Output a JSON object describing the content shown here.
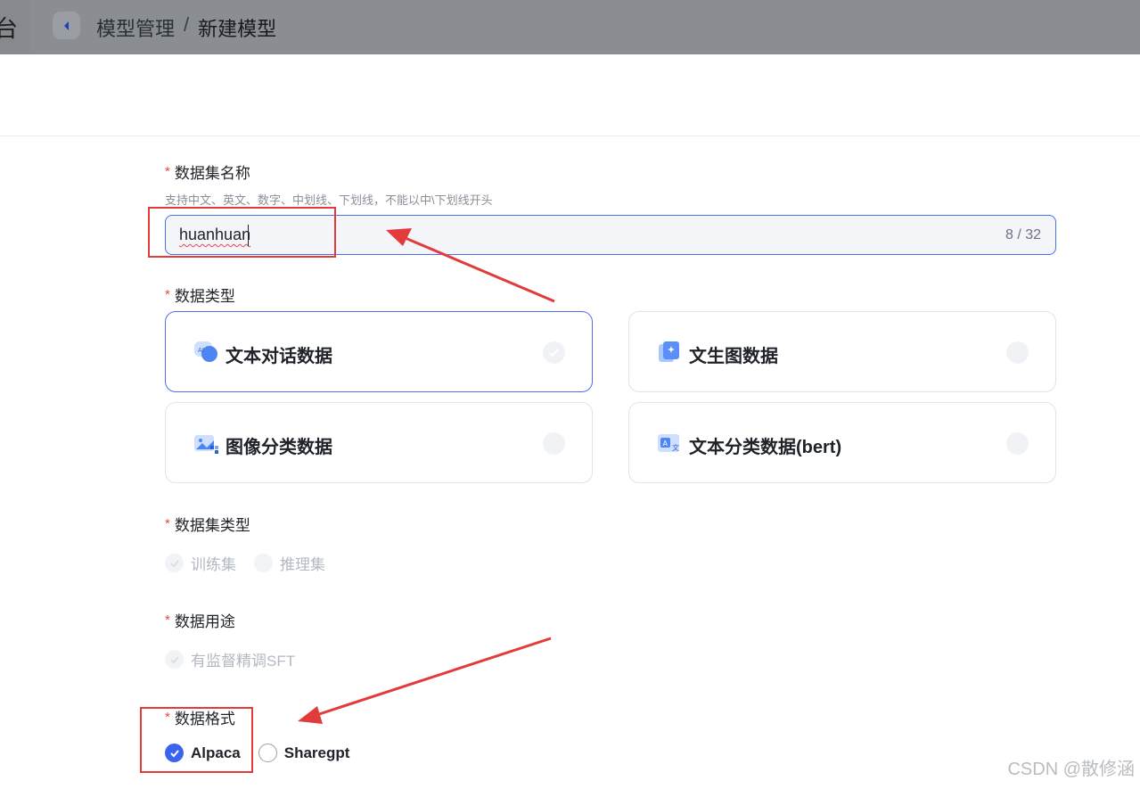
{
  "header": {
    "left_fragment": "台",
    "breadcrumb": [
      "模型管理",
      "/",
      "新建模型"
    ]
  },
  "form": {
    "dataset_name": {
      "label": "数据集名称",
      "hint": "支持中文、英文、数字、中划线、下划线，不能以中\\下划线开头",
      "value": "huanhuan",
      "counter": "8 / 32"
    },
    "data_type": {
      "label": "数据类型",
      "options": [
        {
          "label": "文本对话数据",
          "icon": "chat-ai-icon",
          "selected": true
        },
        {
          "label": "文生图数据",
          "icon": "image-spark-icon",
          "selected": false
        },
        {
          "label": "图像分类数据",
          "icon": "image-grid-icon",
          "selected": false
        },
        {
          "label": "文本分类数据(bert)",
          "icon": "translate-doc-icon",
          "selected": false
        }
      ]
    },
    "dataset_kind": {
      "label": "数据集类型",
      "options": [
        {
          "label": "训练集",
          "state": "disabled-checked"
        },
        {
          "label": "推理集",
          "state": "disabled"
        }
      ]
    },
    "data_use": {
      "label": "数据用途",
      "options": [
        {
          "label": "有监督精调SFT",
          "state": "disabled-checked"
        }
      ]
    },
    "data_format": {
      "label": "数据格式",
      "options": [
        {
          "label": "Alpaca",
          "state": "checked"
        },
        {
          "label": "Sharegpt",
          "state": "unchecked"
        }
      ]
    }
  },
  "colors": {
    "accent": "#3b64ee",
    "required_star": "#e5484d",
    "annotation": "#e23b3b"
  },
  "watermark": "CSDN @散修涵"
}
